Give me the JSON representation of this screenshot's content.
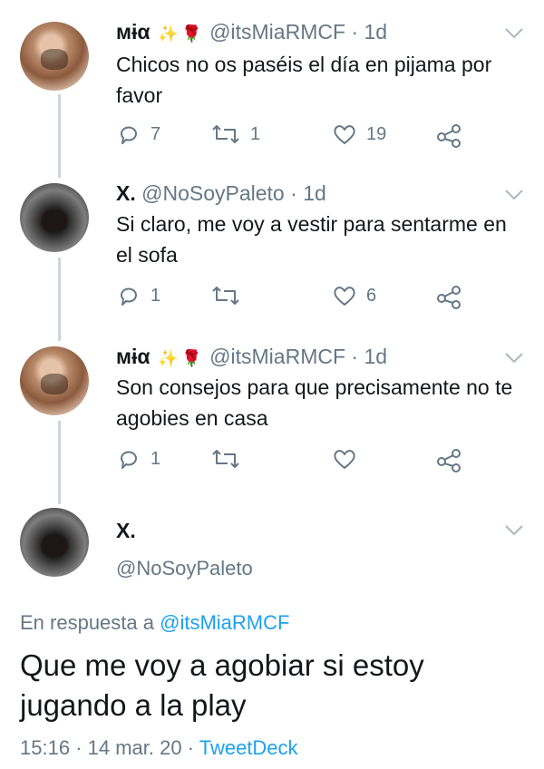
{
  "tweets": [
    {
      "name": "ᴍɨα",
      "emoji_1": "✨",
      "emoji_2": "🌹",
      "handle": "@itsMiaRMCF",
      "sep": "·",
      "time": "1d",
      "text": "Chicos no os paséis el día en pijama por favor",
      "replies": "7",
      "retweets": "1",
      "likes": "19"
    },
    {
      "name": "X.",
      "handle": "@NoSoyPaleto",
      "sep": "·",
      "time": "1d",
      "text": "Si claro, me voy a vestir para sentarme en el sofa",
      "replies": "1",
      "retweets": "",
      "likes": "6"
    },
    {
      "name": "ᴍɨα",
      "emoji_1": "✨",
      "emoji_2": "🌹",
      "handle": "@itsMiaRMCF",
      "sep": "·",
      "time": "1d",
      "text": "Son consejos para que precisamente no te agobies en casa",
      "replies": "1",
      "retweets": "",
      "likes": ""
    }
  ],
  "main_tweet": {
    "name": "X.",
    "handle": "@NoSoyPaleto",
    "reply_prefix": "En respuesta a",
    "reply_handle": "@itsMiaRMCF",
    "text": "Que me voy a agobiar si estoy jugando a la play",
    "timestamp": "15:16 · 14 mar. 20 ·",
    "client": "TweetDeck"
  },
  "colors": {
    "text": "#14171a",
    "secondary": "#657786",
    "link": "#1da1f2",
    "thread_line": "#ccd6dd"
  },
  "icons": [
    "reply-icon",
    "retweet-icon",
    "like-icon",
    "share-icon",
    "chevron-down-icon"
  ]
}
